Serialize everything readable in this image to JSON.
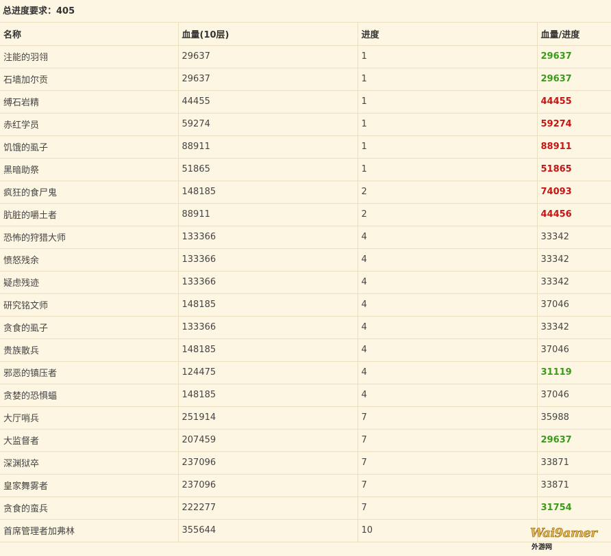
{
  "caption": "总进度要求：405",
  "headers": {
    "name": "名称",
    "hp": "血量(10层)",
    "progress": "进度",
    "ratio": "血量/进度"
  },
  "rows": [
    {
      "name": "注能的羽翎",
      "hp": "29637",
      "progress": "1",
      "ratio": "29637",
      "status": "green"
    },
    {
      "name": "石墙加尔贡",
      "hp": "29637",
      "progress": "1",
      "ratio": "29637",
      "status": "green"
    },
    {
      "name": "缚石岩精",
      "hp": "44455",
      "progress": "1",
      "ratio": "44455",
      "status": "red"
    },
    {
      "name": "赤红学员",
      "hp": "59274",
      "progress": "1",
      "ratio": "59274",
      "status": "red"
    },
    {
      "name": "饥饿的虱子",
      "hp": "88911",
      "progress": "1",
      "ratio": "88911",
      "status": "red"
    },
    {
      "name": "黑暗助祭",
      "hp": "51865",
      "progress": "1",
      "ratio": "51865",
      "status": "red"
    },
    {
      "name": "疯狂的食尸鬼",
      "hp": "148185",
      "progress": "2",
      "ratio": "74093",
      "status": "red"
    },
    {
      "name": "肮脏的嚼土者",
      "hp": "88911",
      "progress": "2",
      "ratio": "44456",
      "status": "red"
    },
    {
      "name": "恐怖的狩猎大师",
      "hp": "133366",
      "progress": "4",
      "ratio": "33342",
      "status": "normal"
    },
    {
      "name": "愤怒残余",
      "hp": "133366",
      "progress": "4",
      "ratio": "33342",
      "status": "normal"
    },
    {
      "name": "疑虑残迹",
      "hp": "133366",
      "progress": "4",
      "ratio": "33342",
      "status": "normal"
    },
    {
      "name": "研究铭文师",
      "hp": "148185",
      "progress": "4",
      "ratio": "37046",
      "status": "normal"
    },
    {
      "name": "贪食的虱子",
      "hp": "133366",
      "progress": "4",
      "ratio": "33342",
      "status": "normal"
    },
    {
      "name": "贵族散兵",
      "hp": "148185",
      "progress": "4",
      "ratio": "37046",
      "status": "normal"
    },
    {
      "name": "邪恶的镇压者",
      "hp": "124475",
      "progress": "4",
      "ratio": "31119",
      "status": "green"
    },
    {
      "name": "贪婪的恐惧蝠",
      "hp": "148185",
      "progress": "4",
      "ratio": "37046",
      "status": "normal"
    },
    {
      "name": "大厅哨兵",
      "hp": "251914",
      "progress": "7",
      "ratio": "35988",
      "status": "normal"
    },
    {
      "name": "大监督者",
      "hp": "207459",
      "progress": "7",
      "ratio": "29637",
      "status": "green"
    },
    {
      "name": "深渊狱卒",
      "hp": "237096",
      "progress": "7",
      "ratio": "33871",
      "status": "normal"
    },
    {
      "name": "皇家舞雾者",
      "hp": "237096",
      "progress": "7",
      "ratio": "33871",
      "status": "normal"
    },
    {
      "name": "贪食的蛮兵",
      "hp": "222277",
      "progress": "7",
      "ratio": "31754",
      "status": "green"
    },
    {
      "name": "首席管理者加弗林",
      "hp": "355644",
      "progress": "10",
      "ratio": "",
      "status": "normal"
    }
  ],
  "colors": {
    "green": "#3a9a1a",
    "red": "#c81414",
    "background": "#fdf6e3",
    "border": "#eadfc2"
  },
  "watermark": {
    "brand": "Wai9amer",
    "sub": "外游网"
  }
}
